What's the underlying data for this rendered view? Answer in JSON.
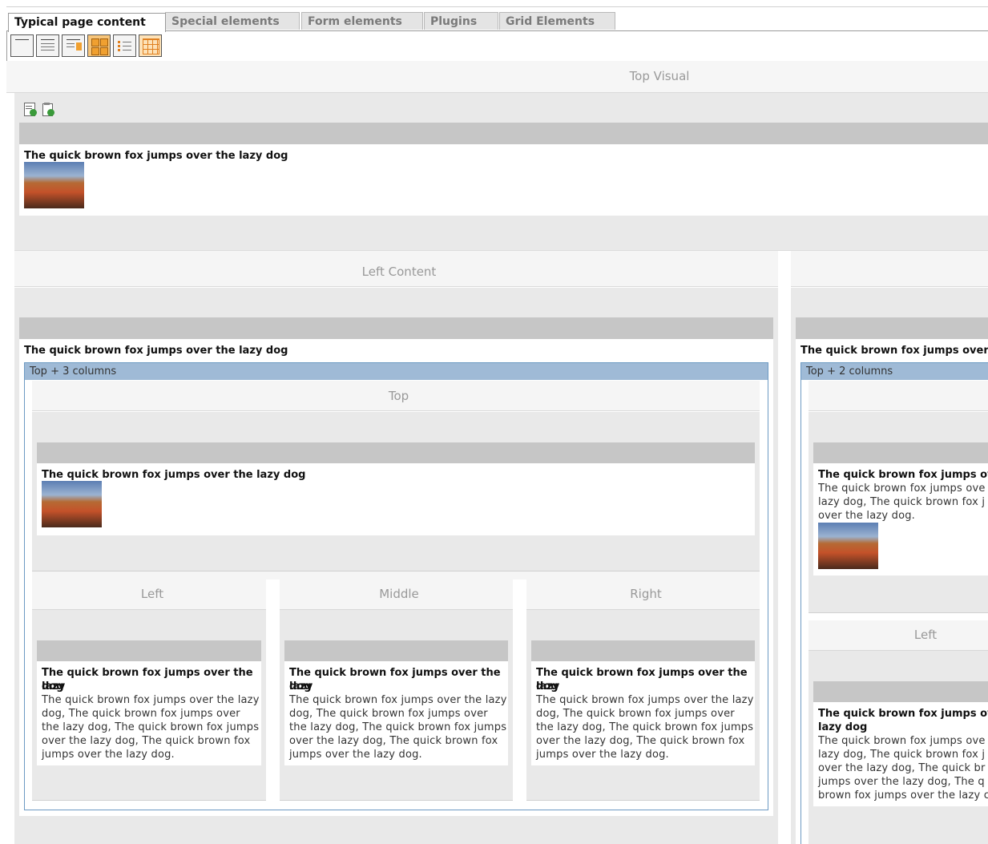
{
  "tabs": [
    {
      "label": "Typical page content",
      "active": true
    },
    {
      "label": "Special elements",
      "active": false
    },
    {
      "label": "Form elements",
      "active": false
    },
    {
      "label": "Plugins",
      "active": false
    },
    {
      "label": "Grid Elements",
      "active": false
    }
  ],
  "wizard_icons": [
    "header-only-icon",
    "text-icon",
    "text-image-right-icon",
    "images-only-icon",
    "bullet-list-icon",
    "table-icon"
  ],
  "top_visual": {
    "header": "Top Visual",
    "toolbar_icons": [
      "new-content-icon",
      "paste-content-icon"
    ],
    "ce_title": "The quick brown fox jumps over the lazy dog"
  },
  "left_content": {
    "header": "Left Content",
    "ce_title": "The quick brown fox jumps over the lazy dog",
    "grid": {
      "type_label": "Top + 3 columns",
      "top_header": "Top",
      "top_ce_title": "The quick brown fox jumps over the lazy dog",
      "columns": [
        {
          "header": "Left",
          "title_line1": "The quick brown fox jumps over the lazy",
          "title_line2": "dog",
          "text": [
            "The quick brown fox jumps over the lazy",
            "dog, The quick brown fox jumps over",
            "the lazy dog, The quick brown fox jumps",
            "over the lazy dog, The quick brown fox",
            "jumps over the lazy dog."
          ]
        },
        {
          "header": "Middle",
          "title_line1": "The quick brown fox jumps over the lazy",
          "title_line2": "dog",
          "text": [
            "The quick brown fox jumps over the lazy",
            "dog, The quick brown fox jumps over",
            "the lazy dog, The quick brown fox jumps",
            "over the lazy dog, The quick brown fox",
            "jumps over the lazy dog."
          ]
        },
        {
          "header": "Right",
          "title_line1": "The quick brown fox jumps over the lazy",
          "title_line2": "dog",
          "text": [
            "The quick brown fox jumps over the lazy",
            "dog, The quick brown fox jumps over",
            "the lazy dog, The quick brown fox jumps",
            "over the lazy dog, The quick brown fox",
            "jumps over the lazy dog."
          ]
        }
      ]
    }
  },
  "right_content": {
    "ce_title": "The quick brown fox jumps over th",
    "grid": {
      "type_label": "Top + 2 columns",
      "top_ce_title": "The quick brown fox jumps ove",
      "top_ce_text": [
        "The quick brown fox jumps ove",
        "lazy dog, The quick brown fox j",
        "over the lazy dog."
      ],
      "left_header": "Left",
      "left_ce_title": [
        "The quick brown fox jumps ove",
        "lazy dog"
      ],
      "left_ce_text": [
        "The quick brown fox jumps ove",
        "lazy dog, The quick brown fox j",
        "over the lazy dog, The quick br",
        "jumps over the lazy dog, The q",
        "brown fox jumps over the lazy c"
      ]
    }
  }
}
